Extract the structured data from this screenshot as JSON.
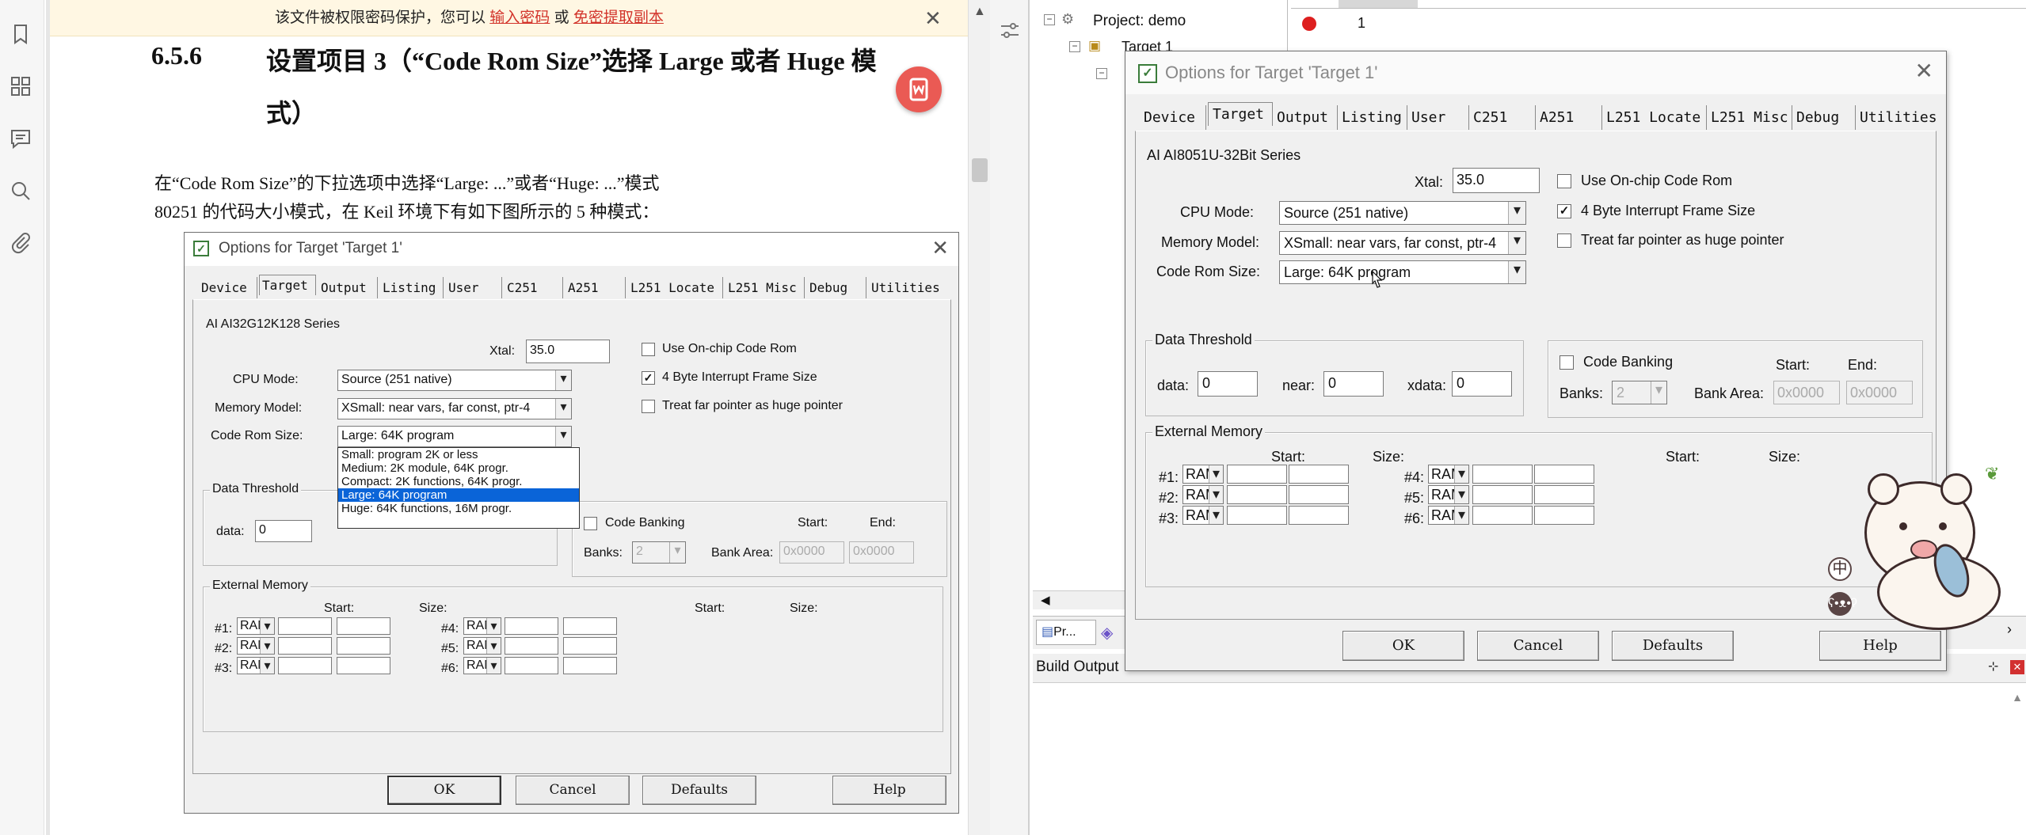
{
  "pdf_reader": {
    "notice": {
      "text": "该文件被权限密码保护，您可以",
      "link1": "输入密码",
      "or": "或",
      "link2": "免密提取副本"
    },
    "heading": {
      "number": "6.5.6",
      "line1": "设置项目 3（“Code Rom Size”选择 Large 或者 Huge 模",
      "line2": "式）"
    },
    "paragraph": [
      "在“Code Rom Size”的下拉选项中选择“Large: ...”或者“Huge: ...”模式",
      "80251 的代码大小模式，在 Keil 环境下有如下图所示的 5 种模式："
    ],
    "rail_icons": [
      "bookmark-icon",
      "thumbnails-icon",
      "comment-icon",
      "search-icon",
      "attachment-icon"
    ]
  },
  "left_dialog": {
    "title": "Options for Target 'Target 1'",
    "close": "✕",
    "tabs": [
      "Device",
      "Target",
      "Output",
      "Listing",
      "User",
      "C251",
      "A251",
      "L251 Locate",
      "L251 Misc",
      "Debug",
      "Utilities"
    ],
    "active_tab": "Target",
    "series": "AI AI32G12K128 Series",
    "xtal_label": "Xtal:",
    "xtal_value": "35.0",
    "cpu_mode_label": "CPU Mode:",
    "cpu_mode_value": "Source (251 native)",
    "memory_model_label": "Memory Model:",
    "memory_model_value": "XSmall: near vars, far const, ptr-4",
    "code_rom_label": "Code Rom Size:",
    "code_rom_value": "Large: 64K program",
    "dropdown_options": [
      "Small: program 2K or less",
      "Medium: 2K module, 64K progr.",
      "Compact: 2K functions, 64K progr.",
      "Large: 64K program",
      "Huge: 64K functions, 16M progr."
    ],
    "dropdown_selected": 3,
    "check_onchip": "Use On-chip Code Rom",
    "check_4byte": "4 Byte Interrupt Frame Size",
    "check_far": "Treat far pointer as huge pointer",
    "data_threshold": "Data Threshold",
    "data_label": "data:",
    "data_value": "0",
    "code_banking": "Code Banking",
    "banks_label": "Banks:",
    "banks_value": "2",
    "bank_area_label": "Bank Area:",
    "start_label": "Start:",
    "end_label": "End:",
    "bank_start": "0x0000",
    "bank_end": "0x0000",
    "external_memory": "External Memory",
    "size_label": "Size:",
    "mem_rows_left": [
      "#1:",
      "#2:",
      "#3:"
    ],
    "mem_rows_right": [
      "#4:",
      "#5:",
      "#6:"
    ],
    "mem_type": "RAM",
    "buttons": {
      "ok": "OK",
      "cancel": "Cancel",
      "defaults": "Defaults",
      "help": "Help"
    }
  },
  "keil": {
    "project_root": "Project: demo",
    "target_node": "Target 1",
    "editor_line_number": "1",
    "project_tab": "Pr...",
    "build_output": "Build Output"
  },
  "right_dialog": {
    "title": "Options for Target 'Target 1'",
    "close": "✕",
    "tabs": [
      "Device",
      "Target",
      "Output",
      "Listing",
      "User",
      "C251",
      "A251",
      "L251 Locate",
      "L251 Misc",
      "Debug",
      "Utilities"
    ],
    "active_tab": "Target",
    "series": "AI AI8051U-32Bit Series",
    "xtal_label": "Xtal:",
    "xtal_value": "35.0",
    "cpu_mode_label": "CPU Mode:",
    "cpu_mode_value": "Source (251 native)",
    "memory_model_label": "Memory Model:",
    "memory_model_value": "XSmall: near vars, far const, ptr-4",
    "code_rom_label": "Code Rom Size:",
    "code_rom_value": "Large: 64K program",
    "check_onchip": "Use On-chip Code Rom",
    "check_4byte": "4 Byte Interrupt Frame Size",
    "check_far": "Treat far pointer as huge pointer",
    "data_threshold": "Data Threshold",
    "data_label": "data:",
    "data_value": "0",
    "near_label": "near:",
    "near_value": "0",
    "xdata_label": "xdata:",
    "xdata_value": "0",
    "code_banking": "Code Banking",
    "banks_label": "Banks:",
    "banks_value": "2",
    "bank_area_label": "Bank Area:",
    "start_label": "Start:",
    "end_label": "End:",
    "bank_start": "0x0000",
    "bank_end": "0x0000",
    "external_memory": "External Memory",
    "size_label": "Size:",
    "mem_rows_left": [
      "#1:",
      "#2:",
      "#3:"
    ],
    "mem_rows_right": [
      "#4:",
      "#5:",
      "#6:"
    ],
    "mem_type": "RAM",
    "buttons": {
      "ok": "OK",
      "cancel": "Cancel",
      "defaults": "Defaults",
      "help": "Help"
    }
  },
  "overlay": {
    "ime_label": "中"
  }
}
